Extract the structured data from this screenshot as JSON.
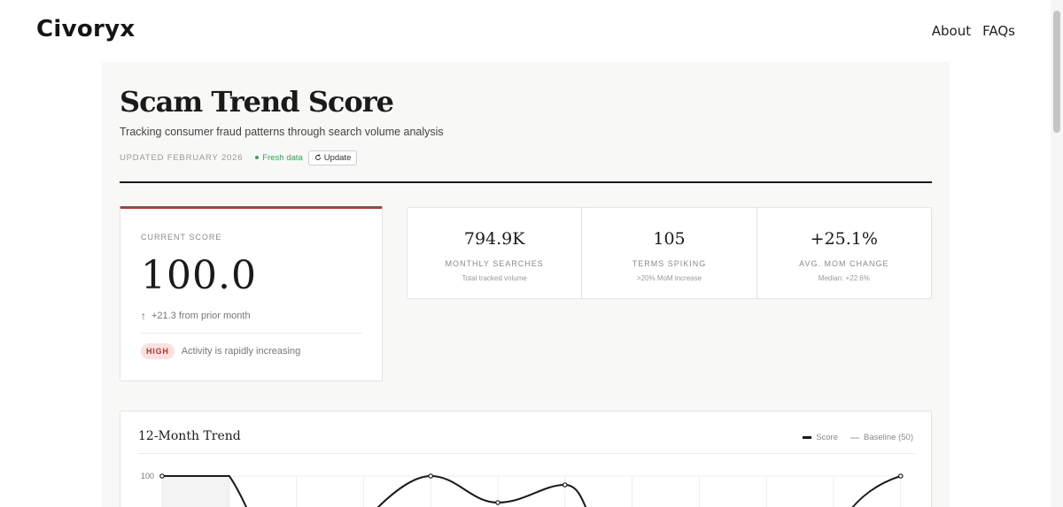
{
  "header": {
    "logo": "Civoryx",
    "nav": [
      {
        "label": "About"
      },
      {
        "label": "FAQs"
      }
    ]
  },
  "page": {
    "title": "Scam Trend Score",
    "subtitle": "Tracking consumer fraud patterns through search volume analysis",
    "updated": "UPDATED FEBRUARY 2026",
    "fresh_label": "Fresh data",
    "update_button": "Update",
    "update_icon": "refresh-icon"
  },
  "score": {
    "label": "CURRENT SCORE",
    "value": "100.0",
    "change_icon": "arrow-up-icon",
    "change": "+21.3 from prior month",
    "level": "HIGH",
    "level_text": "Activity is rapidly increasing",
    "accent_color": "#c0392b"
  },
  "stats": [
    {
      "value": "794.9K",
      "label": "MONTHLY SEARCHES",
      "note": "Total tracked volume"
    },
    {
      "value": "105",
      "label": "TERMS SPIKING",
      "note": ">20% MoM increase"
    },
    {
      "value": "+25.1%",
      "label": "AVG. MOM CHANGE",
      "note": "Median: +22.6%"
    }
  ],
  "trend": {
    "title": "12-Month Trend",
    "legend": [
      {
        "label": "Score"
      },
      {
        "label": "Baseline (50)"
      }
    ],
    "y_tick_top": "100"
  },
  "chart_data": {
    "type": "line",
    "title": "12-Month Trend",
    "xlabel": "",
    "ylabel": "",
    "ylim": [
      0,
      100
    ],
    "grid": true,
    "legend_position": "top-right",
    "visible_points": [
      {
        "index": 1,
        "y": 100
      },
      {
        "index": 5,
        "y": 100
      },
      {
        "index": 6,
        "y": 94
      },
      {
        "index": 7,
        "y": 98
      },
      {
        "index": 12,
        "y": 100
      }
    ],
    "series": [
      {
        "name": "Score"
      },
      {
        "name": "Baseline (50)",
        "constant": 50
      }
    ]
  }
}
